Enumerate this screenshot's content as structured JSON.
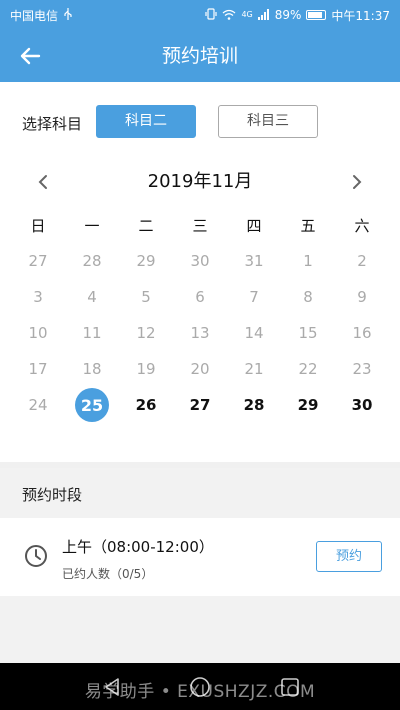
{
  "status_bar": {
    "carrier": "中国电信",
    "usb_icon": "usb-icon",
    "network_type": "4G",
    "battery_percent": "89%",
    "battery_level": 0.89,
    "time": "中午11:37"
  },
  "header": {
    "title": "预约培训",
    "back_icon": "arrow-left-icon"
  },
  "subject": {
    "label": "选择科目",
    "options": [
      {
        "label": "科目二",
        "selected": true
      },
      {
        "label": "科目三",
        "selected": false
      }
    ]
  },
  "calendar": {
    "month_title": "2019年11月",
    "weekdays": [
      "日",
      "一",
      "二",
      "三",
      "四",
      "五",
      "六"
    ],
    "weeks": [
      [
        {
          "d": "27",
          "s": "muted"
        },
        {
          "d": "28",
          "s": "muted"
        },
        {
          "d": "29",
          "s": "muted"
        },
        {
          "d": "30",
          "s": "muted"
        },
        {
          "d": "31",
          "s": "muted"
        },
        {
          "d": "1",
          "s": "muted"
        },
        {
          "d": "2",
          "s": "muted"
        }
      ],
      [
        {
          "d": "3",
          "s": "muted"
        },
        {
          "d": "4",
          "s": "muted"
        },
        {
          "d": "5",
          "s": "muted"
        },
        {
          "d": "6",
          "s": "muted"
        },
        {
          "d": "7",
          "s": "muted"
        },
        {
          "d": "8",
          "s": "muted"
        },
        {
          "d": "9",
          "s": "muted"
        }
      ],
      [
        {
          "d": "10",
          "s": "muted"
        },
        {
          "d": "11",
          "s": "muted"
        },
        {
          "d": "12",
          "s": "muted"
        },
        {
          "d": "13",
          "s": "muted"
        },
        {
          "d": "14",
          "s": "muted"
        },
        {
          "d": "15",
          "s": "muted"
        },
        {
          "d": "16",
          "s": "muted"
        }
      ],
      [
        {
          "d": "17",
          "s": "muted"
        },
        {
          "d": "18",
          "s": "muted"
        },
        {
          "d": "19",
          "s": "muted"
        },
        {
          "d": "20",
          "s": "muted"
        },
        {
          "d": "21",
          "s": "muted"
        },
        {
          "d": "22",
          "s": "muted"
        },
        {
          "d": "23",
          "s": "muted"
        }
      ],
      [
        {
          "d": "24",
          "s": "muted"
        },
        {
          "d": "25",
          "s": "selected"
        },
        {
          "d": "26",
          "s": "avail"
        },
        {
          "d": "27",
          "s": "avail"
        },
        {
          "d": "28",
          "s": "avail"
        },
        {
          "d": "29",
          "s": "avail"
        },
        {
          "d": "30",
          "s": "avail"
        }
      ]
    ]
  },
  "slots": {
    "section_title": "预约时段",
    "items": [
      {
        "time": "上午（08:00-12:00）",
        "count": "已约人数（0/5）",
        "button": "预约",
        "icon": "clock-icon"
      }
    ]
  },
  "watermark": "易学助手 • EXUSHZJZ.COM",
  "colors": {
    "accent": "#4a9fdf",
    "muted_text": "#aaaaaa",
    "section_bg": "#f2f2f2"
  }
}
